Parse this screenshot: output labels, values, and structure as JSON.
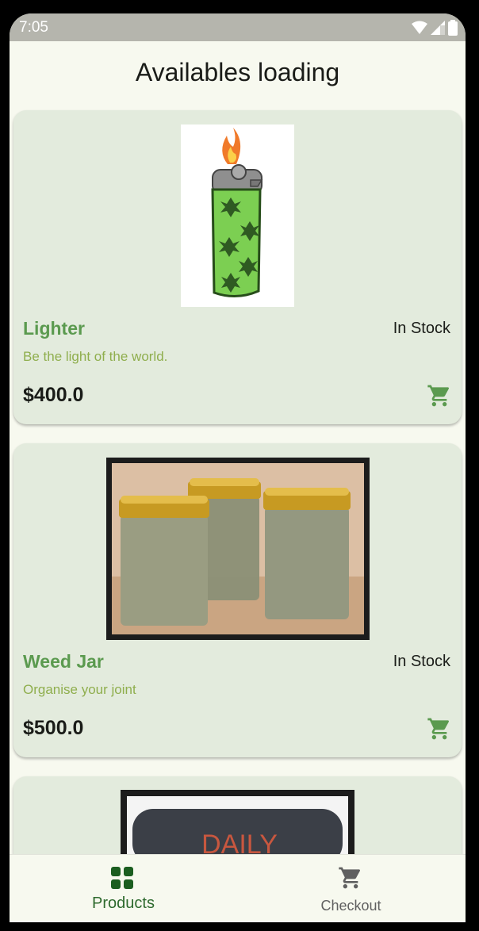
{
  "status_bar": {
    "time": "7:05"
  },
  "header": {
    "title": "Availables loading"
  },
  "products": [
    {
      "name": "Lighter",
      "stock": "In Stock",
      "description": "Be the light of the world.",
      "price": "$400.0",
      "image_icon": "lighter-image"
    },
    {
      "name": "Weed Jar",
      "stock": "In Stock",
      "description": "Organise your joint",
      "price": "$500.0",
      "image_icon": "jars-image"
    },
    {
      "image_icon": "rolling-tray-image",
      "tray_text": "DAILY"
    }
  ],
  "bottom_nav": {
    "products_label": "Products",
    "checkout_label": "Checkout",
    "active": "Products"
  },
  "colors": {
    "accent": "#5b9a4f",
    "active_icon": "#1b5e20",
    "card_bg": "#e3ebdd",
    "page_bg": "#f7f9ef"
  }
}
